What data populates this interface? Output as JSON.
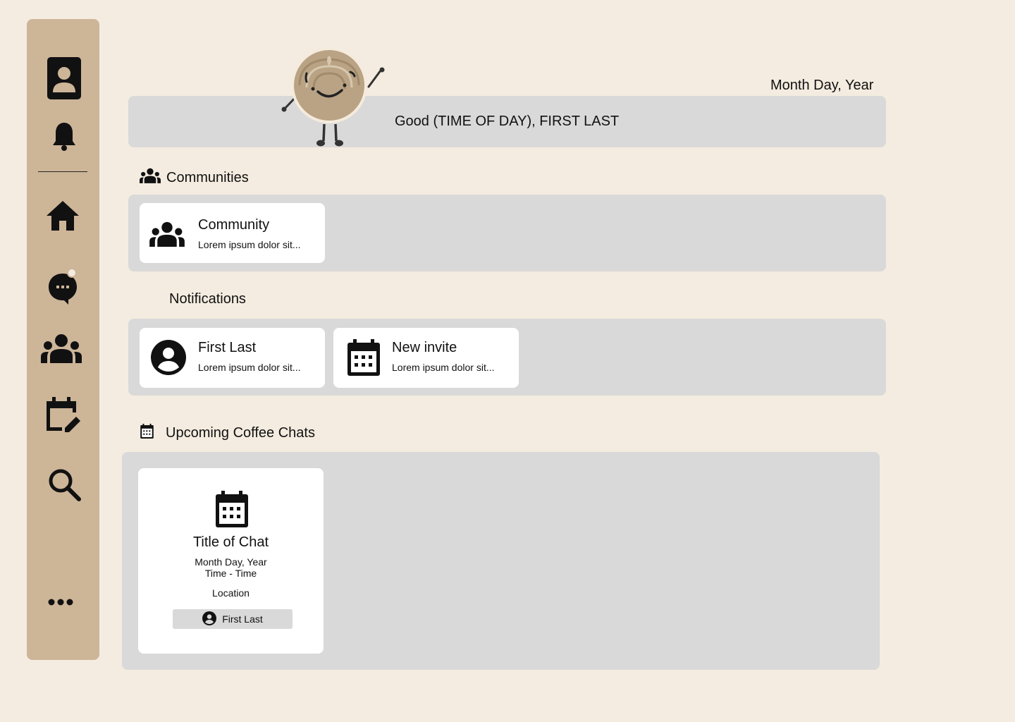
{
  "sidebar": {
    "icons": [
      "contact-card-icon",
      "bell-icon",
      "home-icon",
      "chat-bubble-icon",
      "groups-icon",
      "calendar-edit-icon",
      "search-icon",
      "more-icon"
    ],
    "chat_badge": true
  },
  "header": {
    "date": "Month Day, Year",
    "greeting": "Good (TIME OF DAY), FIRST LAST"
  },
  "communities": {
    "title": "Communities",
    "items": [
      {
        "title": "Community",
        "subtitle": "Lorem ipsum dolor sit..."
      }
    ]
  },
  "notifications": {
    "title": "Notifications",
    "items": [
      {
        "title": "First Last",
        "subtitle": "Lorem ipsum dolor sit...",
        "icon": "account-circle-icon"
      },
      {
        "title": "New invite",
        "subtitle": "Lorem ipsum dolor sit...",
        "icon": "calendar-icon"
      }
    ]
  },
  "coffee_chats": {
    "title": "Upcoming Coffee Chats",
    "items": [
      {
        "title": "Title of Chat",
        "date": "Month Day, Year",
        "time": "Time - Time",
        "location": "Location",
        "person": "First Last"
      }
    ]
  },
  "colors": {
    "background": "#f4ece0",
    "sidebar": "#cdb598",
    "panel": "#d9d9d9",
    "card": "#ffffff",
    "mascot": "#b9a384"
  }
}
